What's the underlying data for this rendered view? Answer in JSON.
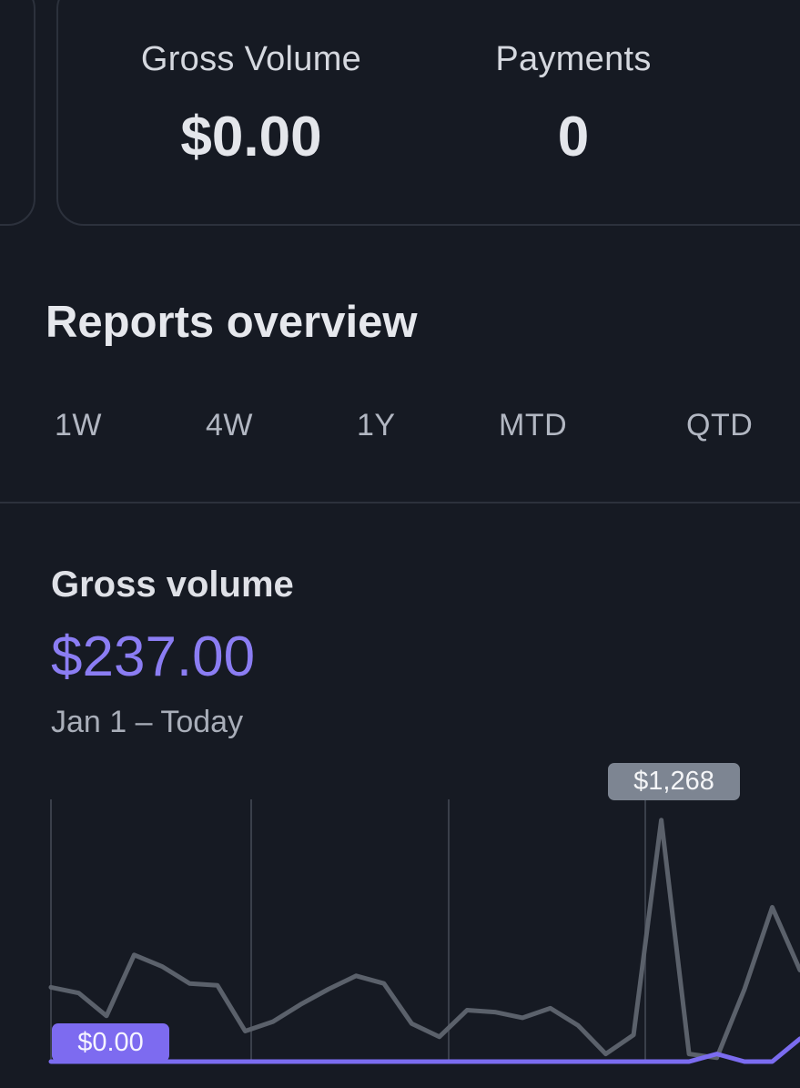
{
  "summary": {
    "gross_volume_label": "Gross Volume",
    "gross_volume_value": "$0.00",
    "payments_label": "Payments",
    "payments_value": "0"
  },
  "reports": {
    "title": "Reports overview",
    "tabs": [
      "1W",
      "4W",
      "1Y",
      "MTD",
      "QTD"
    ]
  },
  "metric": {
    "title": "Gross volume",
    "value": "$237.00",
    "range": "Jan 1 – Today"
  },
  "chart_data": {
    "type": "line",
    "peak_label": "$1,268",
    "start_label": "$0.00",
    "colors": {
      "current": "#7b6cf0",
      "previous": "#5b616b",
      "grid": "#3a3f4a"
    },
    "ylim": [
      0,
      1300
    ],
    "series": [
      {
        "values": [
          390,
          360,
          240,
          560,
          500,
          410,
          400,
          160,
          210,
          300,
          380,
          450,
          410,
          200,
          130,
          270,
          260,
          230,
          280,
          190,
          40,
          140,
          1268,
          40,
          20,
          380,
          810,
          480
        ]
      },
      {
        "values": [
          0,
          0,
          0,
          0,
          0,
          0,
          0,
          0,
          0,
          0,
          0,
          0,
          0,
          0,
          0,
          0,
          0,
          0,
          0,
          0,
          0,
          0,
          0,
          0,
          40,
          0,
          0,
          120
        ]
      }
    ]
  }
}
